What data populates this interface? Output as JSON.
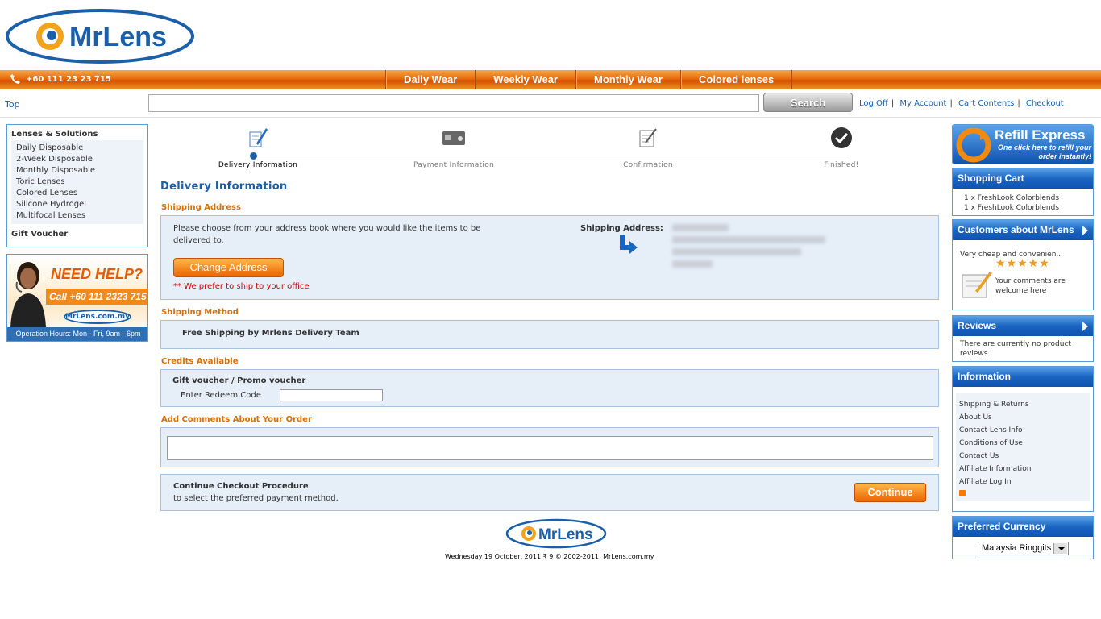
{
  "header": {
    "logo_text": "MrLens",
    "phone": "+60 111 23 23 715",
    "menu": [
      "Daily Wear",
      "Weekly Wear",
      "Monthly Wear",
      "Colored lenses"
    ]
  },
  "searchbar": {
    "top_link": "Top",
    "search_value": "",
    "search_button": "Search",
    "links": [
      "Log Off",
      "My Account",
      "Cart Contents",
      "Checkout"
    ]
  },
  "left": {
    "categories_title": "Lenses & Solutions",
    "categories": [
      "Daily Disposable",
      "2-Week Disposable",
      "Monthly Disposable",
      "Toric Lenses",
      "Colored Lenses",
      "Silicone Hydrogel",
      "Multifocal Lenses"
    ],
    "gift_voucher": "Gift Voucher",
    "help": {
      "title": "NEED HELP?",
      "call": "Call +60 111 2323 715",
      "logo": "MrLens.com.my",
      "hours": "Operation Hours: Mon - Fri, 9am - 6pm"
    }
  },
  "progress": {
    "steps": [
      "Delivery Information",
      "Payment Information",
      "Confirmation",
      "Finished!"
    ]
  },
  "main": {
    "title": "Delivery Information",
    "shipping_address": {
      "section": "Shipping Address",
      "message": "Please choose from your address book where you would like the items to be delivered to.",
      "change_button": "Change Address",
      "note": "** We prefer to ship to your office",
      "label": "Shipping Address:"
    },
    "shipping_method": {
      "section": "Shipping Method",
      "text": "Free Shipping by Mrlens Delivery Team"
    },
    "credits": {
      "section": "Credits Available",
      "title": "Gift voucher / Promo voucher",
      "label": "Enter Redeem Code",
      "value": ""
    },
    "comments": {
      "section": "Add Comments About Your Order",
      "value": ""
    },
    "continue": {
      "title": "Continue Checkout Procedure",
      "subtitle": "to select the preferred payment method.",
      "button": "Continue"
    }
  },
  "footer": {
    "logo_text": "MrLens",
    "text": "Wednesday 19 October, 2011  ₹ 9   © 2002-2011, MrLens.com.my"
  },
  "right": {
    "refill": {
      "title": "Refill Express",
      "subtitle": "One click here to refill your order instantly!"
    },
    "cart": {
      "title": "Shopping Cart",
      "items": [
        "1 x FreshLook Colorblends",
        "1 x FreshLook Colorblends"
      ]
    },
    "customers": {
      "title": "Customers about MrLens",
      "quote": "Very cheap and convenien..",
      "stars": "★★★★★",
      "welcome": "Your comments are welcome here"
    },
    "reviews": {
      "title": "Reviews",
      "text": "There are currently no product reviews"
    },
    "information": {
      "title": "Information",
      "links": [
        "Shipping & Returns",
        "About Us",
        "Contact Lens Info",
        "Conditions of Use",
        "Contact Us",
        "Affiliate Information",
        "Affiliate Log In"
      ]
    },
    "currency": {
      "title": "Preferred Currency",
      "selected": "Malaysia Ringgits"
    }
  },
  "colors": {
    "brand_blue": "#1a5fa8",
    "orange": "#e86a0c",
    "panel_bg": "#e6eef8"
  }
}
